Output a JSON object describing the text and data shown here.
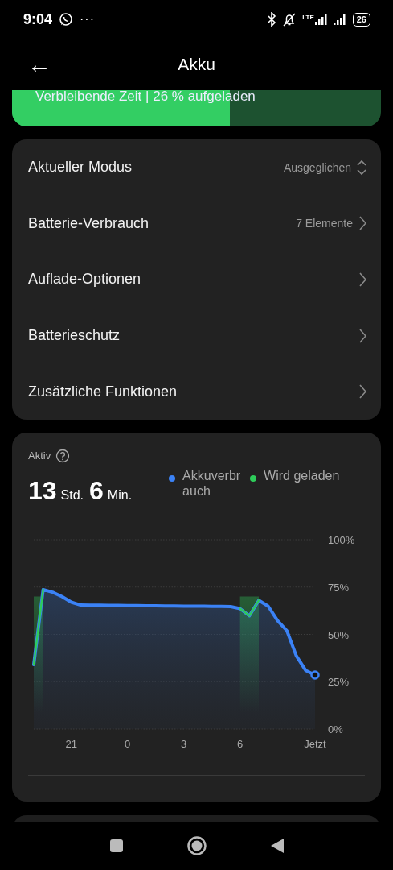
{
  "status_bar": {
    "time": "9:04",
    "more": "···",
    "network": "LTE",
    "battery": "26"
  },
  "header": {
    "back": "←",
    "title": "Akku"
  },
  "battery_banner": {
    "text": "Verbleibende Zeit | 26 % aufgeladen",
    "level": 0.59
  },
  "settings": [
    {
      "label": "Aktueller Modus",
      "value": "Ausgeglichen",
      "kind": "select"
    },
    {
      "label": "Batterie-Verbrauch",
      "value": "7 Elemente",
      "kind": "link"
    },
    {
      "label": "Auflade-Optionen",
      "kind": "link"
    },
    {
      "label": "Batterieschutz",
      "kind": "link"
    },
    {
      "label": "Zusätzliche Funktionen",
      "kind": "link"
    }
  ],
  "usage": {
    "label": "Aktiv",
    "hours": "13",
    "hours_unit": "Std.",
    "minutes": "6",
    "minutes_unit": "Min.",
    "chart_data": {
      "type": "line",
      "ylim": [
        0,
        100
      ],
      "grid": true,
      "categories": [
        null,
        null,
        null,
        null,
        "21",
        null,
        null,
        null,
        null,
        null,
        "0",
        null,
        null,
        null,
        null,
        null,
        "3",
        null,
        null,
        null,
        null,
        null,
        "6",
        null,
        null,
        null,
        null,
        null,
        null,
        null,
        "Jetzt"
      ],
      "series": [
        {
          "name": "Akkuverbrauch",
          "color": "#3b82f6",
          "values": [
            34,
            73.7,
            72.3,
            70,
            67,
            65.5,
            65.4,
            65.4,
            65.3,
            65.3,
            65.2,
            65.2,
            65.1,
            65.1,
            65.0,
            65.0,
            64.9,
            64.9,
            64.9,
            64.8,
            64.8,
            64.7,
            63.6,
            59.8,
            68,
            64.9,
            57.3,
            51.9,
            38.7,
            31,
            28.5
          ]
        },
        {
          "name": "Wird geladen",
          "color": "#2ecc5a",
          "values": [
            34,
            73.7,
            null,
            null,
            null,
            null,
            null,
            null,
            null,
            null,
            null,
            null,
            null,
            null,
            null,
            null,
            null,
            null,
            null,
            null,
            null,
            null,
            63.6,
            59.8,
            68,
            null,
            null,
            null,
            null,
            null,
            null
          ]
        }
      ],
      "yticks": [
        {
          "value": 100,
          "label": "100%"
        },
        {
          "value": 75,
          "label": "75%"
        },
        {
          "value": 50,
          "label": "50%"
        },
        {
          "value": 25,
          "label": "25%"
        },
        {
          "value": 0,
          "label": "0%"
        }
      ]
    }
  }
}
